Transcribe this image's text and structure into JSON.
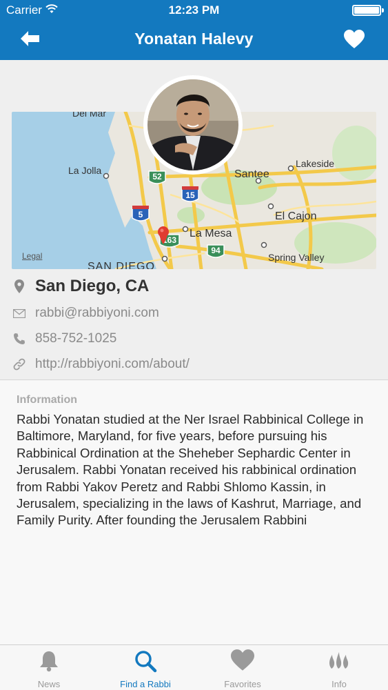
{
  "status_bar": {
    "carrier": "Carrier",
    "time": "12:23 PM"
  },
  "nav": {
    "title": "Yonatan Halevy",
    "back_icon": "arrow-left-icon",
    "favorite_icon": "heart-icon"
  },
  "map": {
    "labels": [
      "Del Mar",
      "La Jolla",
      "Santee",
      "Lakeside",
      "El Cajon",
      "La Mesa",
      "Spring Valley",
      "SAN DIEGO"
    ],
    "shields": [
      "52",
      "15",
      "5",
      "163",
      "94"
    ],
    "legal": "Legal"
  },
  "contact": {
    "location": "San Diego, CA",
    "email": "rabbi@rabbiyoni.com",
    "phone": "858-752-1025",
    "website": "http://rabbiyoni.com/about/"
  },
  "information": {
    "heading": "Information",
    "body": "Rabbi Yonatan studied at the Ner Israel Rabbinical College in Baltimore, Maryland, for five years, before pursuing his Rabbinical Ordination at the Sheheber Sephardic Center in Jerusalem.  Rabbi Yonatan received his rabbinical ordination from Rabbi Yakov Peretz and Rabbi Shlomo Kassin, in Jerusalem, specializing in the laws of Kashrut, Marriage, and Family Purity.  After founding the Jerusalem Rabbini"
  },
  "tabs": [
    {
      "label": "News",
      "icon": "bell-icon",
      "active": false
    },
    {
      "label": "Find a Rabbi",
      "icon": "search-icon",
      "active": true
    },
    {
      "label": "Favorites",
      "icon": "heart-icon",
      "active": false
    },
    {
      "label": "Info",
      "icon": "flames-icon",
      "active": false
    }
  ],
  "colors": {
    "brand": "#1379bf",
    "inactive": "#9a9a9a"
  }
}
